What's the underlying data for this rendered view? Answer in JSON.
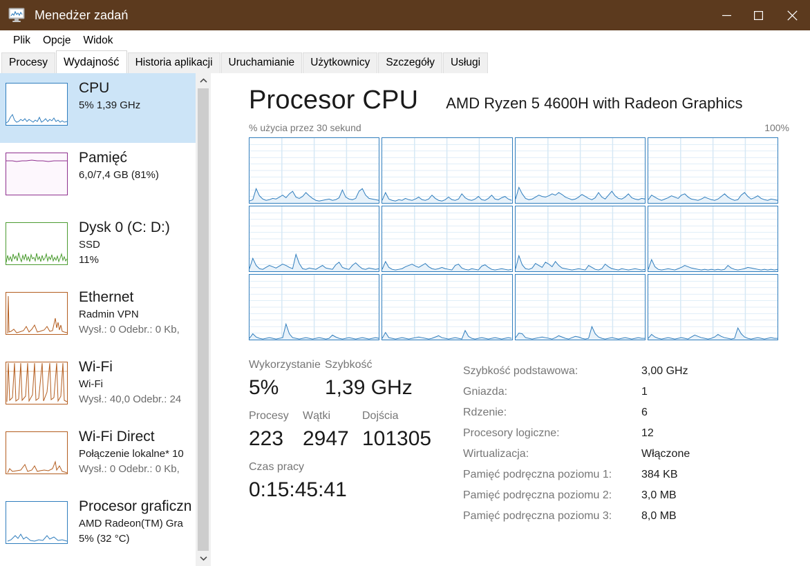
{
  "window": {
    "title": "Menedżer zadań",
    "icon": "task-manager-icon",
    "controls": {
      "minimize": "─",
      "maximize": "□",
      "close": "✕"
    },
    "titlebar_color": "#5c3a1e"
  },
  "menubar": {
    "items": [
      "Plik",
      "Opcje",
      "Widok"
    ]
  },
  "tabs": [
    {
      "label": "Procesy",
      "active": false
    },
    {
      "label": "Wydajność",
      "active": true
    },
    {
      "label": "Historia aplikacji",
      "active": false
    },
    {
      "label": "Uruchamianie",
      "active": false
    },
    {
      "label": "Użytkownicy",
      "active": false
    },
    {
      "label": "Szczegóły",
      "active": false
    },
    {
      "label": "Usługi",
      "active": false
    }
  ],
  "sidebar": {
    "scrollbar": {
      "up_arrow": "⌃",
      "down_arrow": "⌄"
    },
    "items": [
      {
        "title": "CPU",
        "line2": "5%  1,39 GHz",
        "line3": "",
        "selected": true,
        "color": "#2f7dbd"
      },
      {
        "title": "Pamięć",
        "line2": "6,0/7,4 GB (81%)",
        "line3": "",
        "selected": false,
        "color": "#8e2f8e"
      },
      {
        "title": "Dysk 0 (C: D:)",
        "line2": "SSD",
        "line3": "11%",
        "selected": false,
        "color": "#4a9b2f"
      },
      {
        "title": "Ethernet",
        "line2": "Radmin VPN",
        "line3": "Wysł.: 0 Odebr.: 0 Kb,",
        "selected": false,
        "color": "#b35c1e"
      },
      {
        "title": "Wi-Fi",
        "line2": "Wi-Fi",
        "line3": "Wysł.: 40,0 Odebr.: 24",
        "selected": false,
        "color": "#b35c1e"
      },
      {
        "title": "Wi-Fi Direct",
        "line2": "Połączenie lokalne* 10",
        "line3": "Wysł.: 0 Odebr.: 0 Kb,",
        "selected": false,
        "color": "#b35c1e"
      },
      {
        "title": "Procesor graficzn",
        "line2": "AMD Radeon(TM) Gra",
        "line3": "5% (32 °C)",
        "selected": false,
        "color": "#2f7dbd"
      }
    ]
  },
  "main": {
    "title": "Procesor CPU",
    "subtitle": "AMD Ryzen 5 4600H with Radeon Graphics",
    "graph_caption_left": "% użycia przez 30 sekund",
    "graph_caption_right": "100%",
    "stats": {
      "utilization": {
        "label": "Wykorzystanie",
        "value": "5%"
      },
      "speed": {
        "label": "Szybkość",
        "value": "1,39 GHz"
      },
      "processes": {
        "label": "Procesy",
        "value": "223"
      },
      "threads": {
        "label": "Wątki",
        "value": "2947"
      },
      "handles": {
        "label": "Dojścia",
        "value": "101305"
      },
      "uptime": {
        "label": "Czas pracy",
        "value": "0:15:45:41"
      }
    },
    "specs": [
      {
        "key": "Szybkość podstawowa:",
        "value": "3,00 GHz"
      },
      {
        "key": "Gniazda:",
        "value": "1"
      },
      {
        "key": "Rdzenie:",
        "value": "6"
      },
      {
        "key": "Procesory logiczne:",
        "value": "12"
      },
      {
        "key": "Wirtualizacja:",
        "value": "Włączone"
      },
      {
        "key": "Pamięć podręczna poziomu 1:",
        "value": "384 KB"
      },
      {
        "key": "Pamięć podręczna poziomu 2:",
        "value": "3,0 MB"
      },
      {
        "key": "Pamięć podręczna poziomu 3:",
        "value": "8,0 MB"
      }
    ]
  },
  "chart_data": {
    "type": "line",
    "title": "% użycia przez 30 sekund",
    "ylabel": "% użycia",
    "ylim": [
      0,
      100
    ],
    "xlim": [
      0,
      30
    ],
    "grid": true,
    "legend": "none",
    "note": "12 logical processor graphs, 4 columns x 3 rows",
    "series": [
      {
        "name": "CPU 0",
        "values": [
          3,
          5,
          22,
          11,
          6,
          4,
          5,
          7,
          6,
          9,
          12,
          8,
          14,
          18,
          9,
          7,
          10,
          16,
          11,
          7,
          4,
          3,
          4,
          5,
          6,
          4,
          5,
          8,
          20,
          9,
          6,
          5,
          7,
          18,
          22,
          12,
          7,
          6,
          5,
          4
        ]
      },
      {
        "name": "CPU 1",
        "values": [
          4,
          16,
          6,
          4,
          3,
          5,
          4,
          7,
          5,
          4,
          6,
          9,
          5,
          4,
          6,
          12,
          7,
          4,
          3,
          5,
          9,
          5,
          4,
          6,
          14,
          8,
          5,
          4,
          6,
          10,
          5,
          4,
          7,
          12,
          6,
          5,
          8,
          10,
          6,
          4
        ]
      },
      {
        "name": "CPU 2",
        "values": [
          6,
          24,
          14,
          7,
          5,
          6,
          9,
          12,
          10,
          9,
          11,
          14,
          12,
          16,
          13,
          9,
          7,
          5,
          6,
          9,
          13,
          10,
          7,
          5,
          8,
          16,
          9,
          6,
          12,
          18,
          11,
          7,
          6,
          9,
          14,
          8,
          6,
          5,
          7,
          6
        ]
      },
      {
        "name": "CPU 3",
        "values": [
          5,
          12,
          9,
          6,
          4,
          6,
          8,
          11,
          9,
          7,
          12,
          14,
          9,
          6,
          5,
          4,
          6,
          9,
          7,
          5,
          4,
          6,
          10,
          14,
          9,
          6,
          4,
          5,
          12,
          16,
          10,
          6,
          8,
          11,
          7,
          5,
          4,
          6,
          5,
          4
        ]
      },
      {
        "name": "CPU 4",
        "values": [
          4,
          20,
          9,
          4,
          3,
          6,
          9,
          7,
          5,
          8,
          11,
          9,
          6,
          4,
          26,
          12,
          4,
          3,
          5,
          4,
          3,
          6,
          9,
          5,
          4,
          3,
          10,
          14,
          6,
          4,
          3,
          9,
          13,
          8,
          4,
          3,
          5,
          4,
          3,
          4
        ]
      },
      {
        "name": "CPU 5",
        "values": [
          3,
          15,
          6,
          3,
          2,
          3,
          4,
          7,
          9,
          11,
          8,
          6,
          9,
          12,
          7,
          4,
          3,
          4,
          6,
          4,
          3,
          2,
          9,
          11,
          5,
          3,
          2,
          4,
          3,
          2,
          8,
          10,
          6,
          3,
          2,
          3,
          4,
          3,
          2,
          3
        ]
      },
      {
        "name": "CPU 6",
        "values": [
          4,
          24,
          10,
          4,
          3,
          5,
          12,
          9,
          6,
          14,
          11,
          7,
          15,
          9,
          5,
          4,
          3,
          2,
          3,
          4,
          3,
          2,
          9,
          6,
          3,
          2,
          4,
          11,
          7,
          4,
          3,
          2,
          4,
          3,
          2,
          3,
          4,
          3,
          2,
          3
        ]
      },
      {
        "name": "CPU 7",
        "values": [
          3,
          18,
          7,
          3,
          2,
          3,
          4,
          3,
          2,
          4,
          6,
          9,
          7,
          5,
          4,
          3,
          2,
          3,
          2,
          3,
          2,
          3,
          2,
          3,
          9,
          5,
          3,
          2,
          3,
          4,
          6,
          5,
          4,
          3,
          2,
          3,
          2,
          3,
          2,
          3
        ]
      },
      {
        "name": "CPU 8",
        "values": [
          2,
          9,
          4,
          2,
          1,
          2,
          3,
          2,
          1,
          2,
          3,
          24,
          9,
          3,
          2,
          1,
          2,
          3,
          2,
          1,
          2,
          3,
          2,
          1,
          2,
          7,
          4,
          2,
          1,
          2,
          3,
          2,
          1,
          2,
          3,
          2,
          1,
          2,
          3,
          2
        ]
      },
      {
        "name": "CPU 9",
        "values": [
          2,
          11,
          3,
          2,
          1,
          2,
          3,
          2,
          1,
          2,
          3,
          4,
          3,
          2,
          1,
          2,
          4,
          6,
          3,
          2,
          1,
          2,
          3,
          2,
          1,
          14,
          5,
          2,
          1,
          2,
          3,
          2,
          1,
          2,
          3,
          2,
          1,
          2,
          3,
          2
        ]
      },
      {
        "name": "CPU 10",
        "values": [
          3,
          10,
          9,
          3,
          2,
          1,
          2,
          3,
          4,
          3,
          2,
          1,
          3,
          6,
          4,
          2,
          1,
          3,
          5,
          4,
          2,
          1,
          2,
          20,
          9,
          4,
          2,
          1,
          2,
          3,
          2,
          1,
          2,
          3,
          2,
          1,
          2,
          3,
          2,
          2
        ]
      },
      {
        "name": "CPU 11",
        "values": [
          2,
          8,
          4,
          2,
          1,
          2,
          3,
          2,
          1,
          2,
          3,
          2,
          1,
          4,
          7,
          5,
          3,
          2,
          1,
          2,
          4,
          8,
          5,
          3,
          2,
          1,
          2,
          18,
          9,
          4,
          2,
          1,
          2,
          3,
          2,
          1,
          2,
          3,
          2,
          2
        ]
      }
    ]
  }
}
